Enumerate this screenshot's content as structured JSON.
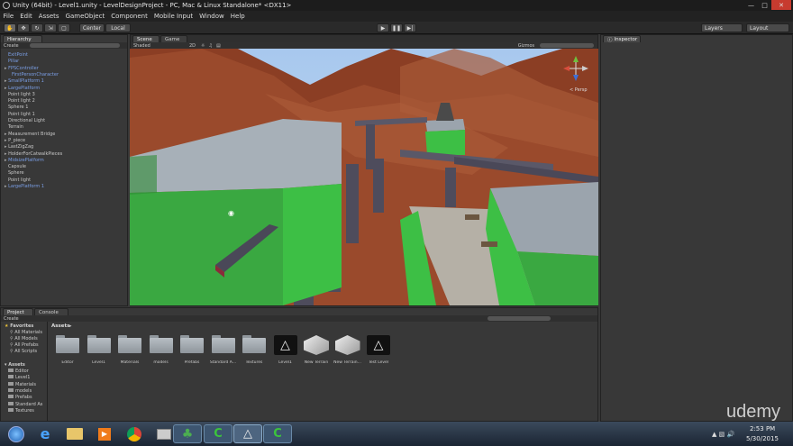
{
  "window": {
    "title": "Unity (64bit) - Level1.unity - LevelDesignProject - PC, Mac & Linux Standalone* <DX11>"
  },
  "menu": [
    "File",
    "Edit",
    "Assets",
    "GameObject",
    "Component",
    "Mobile Input",
    "Window",
    "Help"
  ],
  "toolbar": {
    "pivot_label": "Center",
    "space_label": "Local",
    "layers_label": "Layers",
    "layout_label": "Layout"
  },
  "hierarchy": {
    "tab": "Hierarchy",
    "create_label": "Create",
    "items": [
      {
        "label": "ExitPoint",
        "blue": true,
        "indent": 1,
        "arrow": false
      },
      {
        "label": "Pillar",
        "blue": true,
        "indent": 1,
        "arrow": false
      },
      {
        "label": "FPSController",
        "blue": true,
        "indent": 0,
        "arrow": true
      },
      {
        "label": "FirstPersonCharacter",
        "blue": true,
        "indent": 2,
        "arrow": false
      },
      {
        "label": "SmallPlatform 1",
        "blue": true,
        "indent": 0,
        "arrow": true
      },
      {
        "label": "LargePlatform",
        "blue": true,
        "indent": 0,
        "arrow": true
      },
      {
        "label": "Point light 3",
        "blue": false,
        "indent": 1,
        "arrow": false
      },
      {
        "label": "Point light 2",
        "blue": false,
        "indent": 1,
        "arrow": false
      },
      {
        "label": "Sphere 1",
        "blue": false,
        "indent": 1,
        "arrow": false
      },
      {
        "label": "Point light 1",
        "blue": false,
        "indent": 1,
        "arrow": false
      },
      {
        "label": "Directional Light",
        "blue": false,
        "indent": 1,
        "arrow": false
      },
      {
        "label": "Terrain",
        "blue": false,
        "indent": 1,
        "arrow": false
      },
      {
        "label": "Measurement Bridge",
        "blue": false,
        "indent": 0,
        "arrow": true
      },
      {
        "label": "P_piece",
        "blue": false,
        "indent": 0,
        "arrow": true
      },
      {
        "label": "LastZigZag",
        "blue": false,
        "indent": 0,
        "arrow": true
      },
      {
        "label": "HolderForCatwalkPieces",
        "blue": false,
        "indent": 0,
        "arrow": true
      },
      {
        "label": "MidsizePlatform",
        "blue": true,
        "indent": 0,
        "arrow": true
      },
      {
        "label": "Capsule",
        "blue": false,
        "indent": 1,
        "arrow": false
      },
      {
        "label": "Sphere",
        "blue": false,
        "indent": 1,
        "arrow": false
      },
      {
        "label": "Point light",
        "blue": false,
        "indent": 1,
        "arrow": false
      },
      {
        "label": "LargePlatform 1",
        "blue": true,
        "indent": 0,
        "arrow": true
      }
    ]
  },
  "scene": {
    "tab_scene": "Scene",
    "tab_game": "Game",
    "shading": "Shaded",
    "mode_2d": "2D",
    "gizmos": "Gizmos",
    "persp": "< Persp"
  },
  "inspector": {
    "tab": "Inspector"
  },
  "project": {
    "tab_project": "Project",
    "tab_console": "Console",
    "create_label": "Create",
    "favorites_label": "Favorites",
    "favorites": [
      "All Materials",
      "All Models",
      "All Prefabs",
      "All Scripts"
    ],
    "assets_root": "Assets",
    "tree": [
      "Editor",
      "Level1",
      "Materials",
      "models",
      "Prefabs",
      "Standard As",
      "Textures"
    ],
    "breadcrumb": "Assets",
    "assets": [
      {
        "label": "Editor",
        "kind": "folder"
      },
      {
        "label": "Level1",
        "kind": "folder"
      },
      {
        "label": "Materials",
        "kind": "folder"
      },
      {
        "label": "models",
        "kind": "folder"
      },
      {
        "label": "Prefabs",
        "kind": "folder"
      },
      {
        "label": "Standard A...",
        "kind": "folder"
      },
      {
        "label": "Textures",
        "kind": "folder"
      },
      {
        "label": "Level1",
        "kind": "unity"
      },
      {
        "label": "New Terrain",
        "kind": "terrain"
      },
      {
        "label": "New Terrain...",
        "kind": "terrain"
      },
      {
        "label": "Test Level",
        "kind": "unity"
      }
    ]
  },
  "taskbar": {
    "time": "2:53 PM",
    "date": "5/30/2015",
    "watermark": "udemy"
  },
  "colors": {
    "green": "#3dbf45",
    "terrain": "#9a4a2c",
    "sky": "#b4d0ef"
  }
}
